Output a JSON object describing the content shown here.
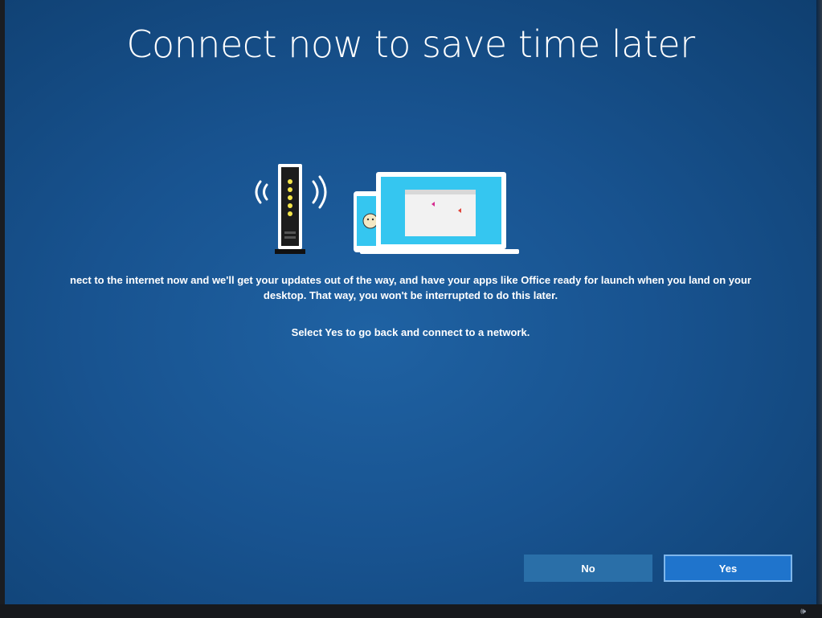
{
  "page": {
    "title": "Connect now to save time later",
    "body_line1": "nect to the internet now and we'll get your updates out of the way, and have your apps like Office ready for launch when you land on your",
    "body_line2": "desktop. That way, you won't be interrupted to do this later.",
    "prompt": "Select Yes to go back and connect to a network."
  },
  "buttons": {
    "no_label": "No",
    "yes_label": "Yes"
  },
  "tray": {
    "volume_icon": "speaker-icon",
    "volume_glyph": "🕪"
  },
  "colors": {
    "background": "#185390",
    "button_no": "#2a6fa8",
    "button_yes": "#1f74cc",
    "accent_cyan": "#35c6f0"
  }
}
